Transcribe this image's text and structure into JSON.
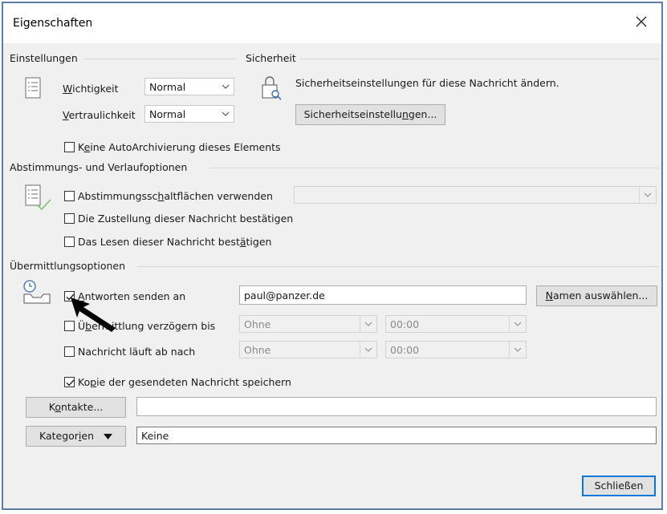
{
  "dialog": {
    "title": "Eigenschaften"
  },
  "einstellungen": {
    "group_label": "Einstellungen",
    "wichtigkeit": {
      "label_pre": "",
      "label_u": "W",
      "label_post": "ichtigkeit",
      "value": "Normal"
    },
    "vertraulichkeit": {
      "label_pre": "",
      "label_u": "V",
      "label_post": "ertraulichkeit",
      "value": "Normal"
    },
    "keine_autoarchivierung": {
      "label_pre": "K",
      "label_u": "e",
      "label_post": "ine AutoArchivierung dieses Elements",
      "checked": false
    }
  },
  "sicherheit": {
    "group_label": "Sicherheit",
    "description": "Sicherheitseinstellungen für diese Nachricht ändern.",
    "button": {
      "label_pre": "Sicherheitseinstellu",
      "label_u": "n",
      "label_post": "gen..."
    }
  },
  "abstimmung": {
    "group_label": "Abstimmungs- und Verlaufoptionen",
    "abstimmungsschaltflaechen": {
      "label_pre": "Abstimmungssc",
      "label_u": "h",
      "label_post": "altflächen verwenden",
      "checked": false,
      "value": ""
    },
    "zustellung": {
      "label_pre": "Die Zustellun",
      "label_u": "g",
      "label_post": " dieser Nachricht bestätigen",
      "checked": false
    },
    "lesen": {
      "label_pre": "Das Lesen dieser Nachricht best",
      "label_u": "ä",
      "label_post": "tigen",
      "checked": false
    }
  },
  "uebermittlung": {
    "group_label": "Übermittlungsoptionen",
    "antworten": {
      "label_pre": "",
      "label_u": "A",
      "label_post": "ntworten senden an",
      "checked": true,
      "value": "paul@panzer.de"
    },
    "namen_button": {
      "label_pre": "",
      "label_u": "N",
      "label_post": "amen auswählen..."
    },
    "verzoegern": {
      "label_pre": "Ü",
      "label_u": "b",
      "label_post": "ermittlung verzögern bis",
      "checked": false,
      "date": "Ohne",
      "time": "00:00"
    },
    "ablauf": {
      "label_pre": "Nachricht läuft ab nach",
      "checked": false,
      "date": "Ohne",
      "time": "00:00"
    },
    "kopie": {
      "label_pre": "Ko",
      "label_u": "p",
      "label_post": "ie der gesendeten Nachricht speichern",
      "checked": true
    }
  },
  "kontakte": {
    "label_pre": "K",
    "label_u": "o",
    "label_post": "ntakte...",
    "value": ""
  },
  "kategorien": {
    "label_pre": "Kategor",
    "label_u": "i",
    "label_post": "en",
    "value": "Keine"
  },
  "footer": {
    "close_label": "Schließen"
  },
  "colors": {
    "accent": "#0078d7",
    "border": "#5b7ea6",
    "icon_green": "#7cc36b",
    "icon_blue": "#3a6fb0"
  }
}
